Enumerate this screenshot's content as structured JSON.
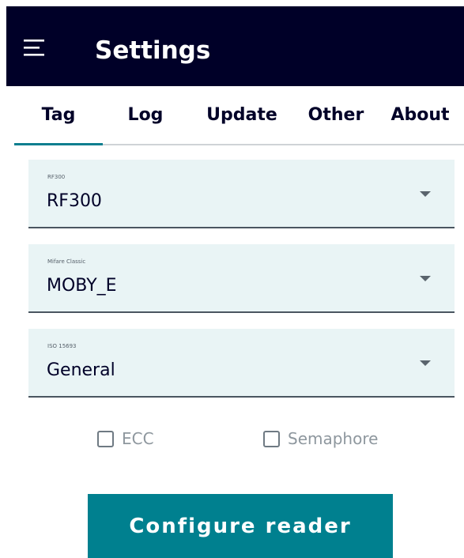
{
  "app_bar": {
    "title": "Settings",
    "menu_icon": "hamburger-menu-icon",
    "background_color": "#000028"
  },
  "tabs": [
    {
      "label": "Tag",
      "active": true
    },
    {
      "label": "Log",
      "active": false
    },
    {
      "label": "Update",
      "active": false
    },
    {
      "label": "Other",
      "active": false
    },
    {
      "label": "About",
      "active": false
    }
  ],
  "fields": [
    {
      "label": "RF300",
      "value": "RF300",
      "icon": "dropdown-arrow-icon"
    },
    {
      "label": "Mifare Classic",
      "value": "MOBY_E",
      "icon": "dropdown-arrow-icon"
    },
    {
      "label": "ISO 15693",
      "value": "General",
      "icon": "dropdown-arrow-icon"
    }
  ],
  "options": {
    "ecc": {
      "label": "ECC",
      "checked": false
    },
    "semaphore": {
      "label": "Semaphore",
      "checked": false
    }
  },
  "actions": {
    "configure_label": "Configure reader",
    "accent_color": "#00808f"
  }
}
